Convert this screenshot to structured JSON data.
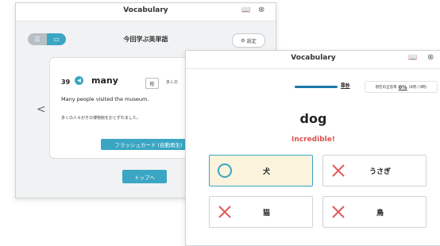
{
  "back_window": {
    "title": "Vocabulary",
    "section_title": "今回学ぶ英単語",
    "settings_label": "設定",
    "card": {
      "number": "39",
      "word": "many",
      "pos": "形",
      "meaning": "多くの",
      "sentence": "Many people visited the museum.",
      "translation": "多くの人々がその博物館をおとずれました。",
      "flashcard_button": "フラッシュカード (自動再生)"
    },
    "top_button": "トップへ"
  },
  "front_window": {
    "title": "Vocabulary",
    "timer": {
      "value": "8",
      "unit": "秒"
    },
    "rate": {
      "label": "現在の正答率",
      "value": "0%",
      "detail": "(0問 / 0問)"
    },
    "question_word": "dog",
    "feedback": "Incredible!",
    "options": [
      {
        "label": "犬",
        "state": "correct"
      },
      {
        "label": "うさぎ",
        "state": "wrong"
      },
      {
        "label": "猫",
        "state": "wrong"
      },
      {
        "label": "鳥",
        "state": "wrong"
      }
    ]
  },
  "colors": {
    "accent": "#3aa6c3",
    "wrong": "#e05a5a",
    "correct_bg": "#fbf3dc",
    "feedback": "#d9534f"
  }
}
